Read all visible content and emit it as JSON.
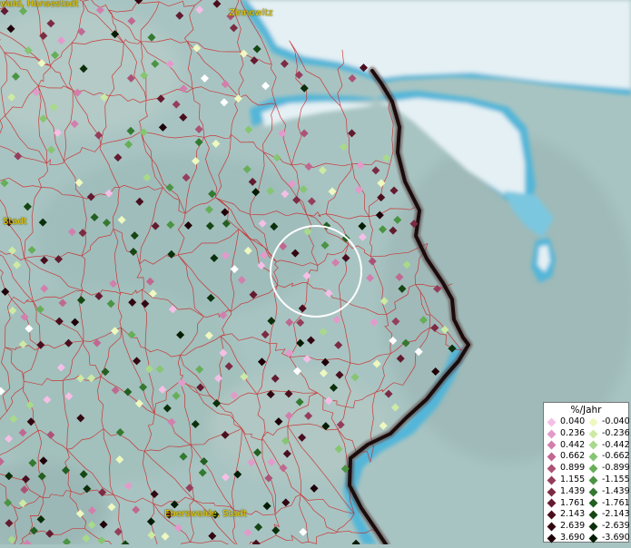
{
  "place_labels": {
    "greifswald": "wald, Hansestadt",
    "zinnowitz": "Zinnowitz",
    "stadt": "Stadt",
    "eberswalde": "Eberswalde, Stadt"
  },
  "legend": {
    "title": "%/Jahr",
    "positive": [
      {
        "value": "0.040",
        "color": "#f4bfe6"
      },
      {
        "value": "0.236",
        "color": "#e39acb"
      },
      {
        "value": "0.442",
        "color": "#d27fad"
      },
      {
        "value": "0.662",
        "color": "#c06891"
      },
      {
        "value": "0.899",
        "color": "#ab5276"
      },
      {
        "value": "1.155",
        "color": "#943e5c"
      },
      {
        "value": "1.439",
        "color": "#7c2b44"
      },
      {
        "value": "1.761",
        "color": "#631b30"
      },
      {
        "value": "2.143",
        "color": "#4a0f1f"
      },
      {
        "value": "2.639",
        "color": "#330712"
      },
      {
        "value": "3.690",
        "color": "#1f0209"
      }
    ],
    "negative": [
      {
        "value": "-0.040",
        "color": "#eef8bf"
      },
      {
        "value": "-0.236",
        "color": "#cdeaa4"
      },
      {
        "value": "-0.442",
        "color": "#a9d98a"
      },
      {
        "value": "-0.662",
        "color": "#86c571"
      },
      {
        "value": "-0.899",
        "color": "#66ae58"
      },
      {
        "value": "-1.155",
        "color": "#4b9443"
      },
      {
        "value": "-1.439",
        "color": "#347930"
      },
      {
        "value": "-1.761",
        "color": "#225f21"
      },
      {
        "value": "-2.143",
        "color": "#154614"
      },
      {
        "value": "-2.639",
        "color": "#0b300b"
      },
      {
        "value": "-3.690",
        "color": "#041c04"
      }
    ]
  },
  "colors": {
    "land": "#a8c4c2",
    "water": "#e4f0f4",
    "water_edge": "#52b6d8",
    "boundary": "#cc2222",
    "border_line": "#1a0c0c",
    "label": "#f0d000",
    "highlight_circle": "#ffffff"
  }
}
